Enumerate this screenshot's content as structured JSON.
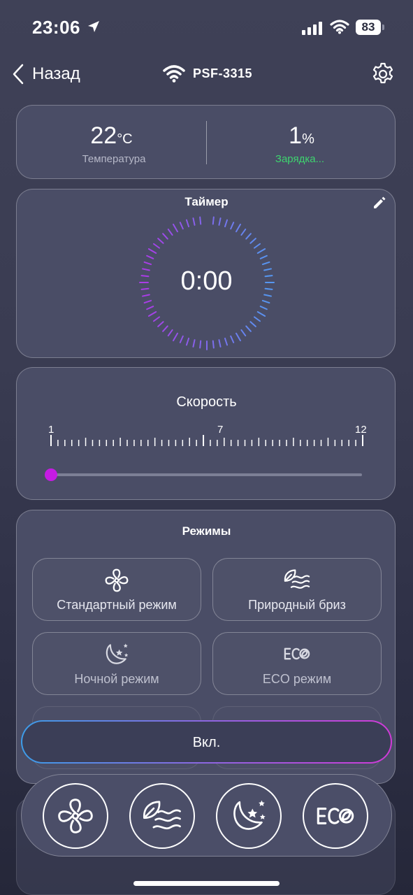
{
  "status_bar": {
    "time": "23:06",
    "battery": "83"
  },
  "nav": {
    "back_label": "Назад",
    "device_name": "PSF-3315"
  },
  "info": {
    "temperature": {
      "value": "22",
      "unit": "°C",
      "label": "Температура"
    },
    "battery": {
      "value": "1",
      "unit": "%",
      "label": "Зарядка..."
    }
  },
  "timer": {
    "title": "Таймер",
    "value": "0:00"
  },
  "speed": {
    "title": "Скорость",
    "min_label": "1",
    "mid_label": "7",
    "max_label": "12",
    "current": 1
  },
  "modes": {
    "title": "Режимы",
    "items": [
      {
        "label": "Стандартный режим",
        "icon": "fan-icon"
      },
      {
        "label": "Природный бриз",
        "icon": "leaf-waves-icon"
      },
      {
        "label": "Ночной режим",
        "icon": "moon-stars-icon"
      },
      {
        "label": "ECO режим",
        "icon": "eco-icon"
      }
    ]
  },
  "power_button": {
    "label": "Вкл."
  },
  "dock": {
    "items": [
      "fan-icon",
      "leaf-waves-icon",
      "moon-stars-icon",
      "eco-icon"
    ]
  },
  "colors": {
    "accent_purple": "#c51be3",
    "charging_green": "#3ed46f",
    "gradient_start": "#3d9ce8",
    "gradient_end": "#d13ad8"
  }
}
